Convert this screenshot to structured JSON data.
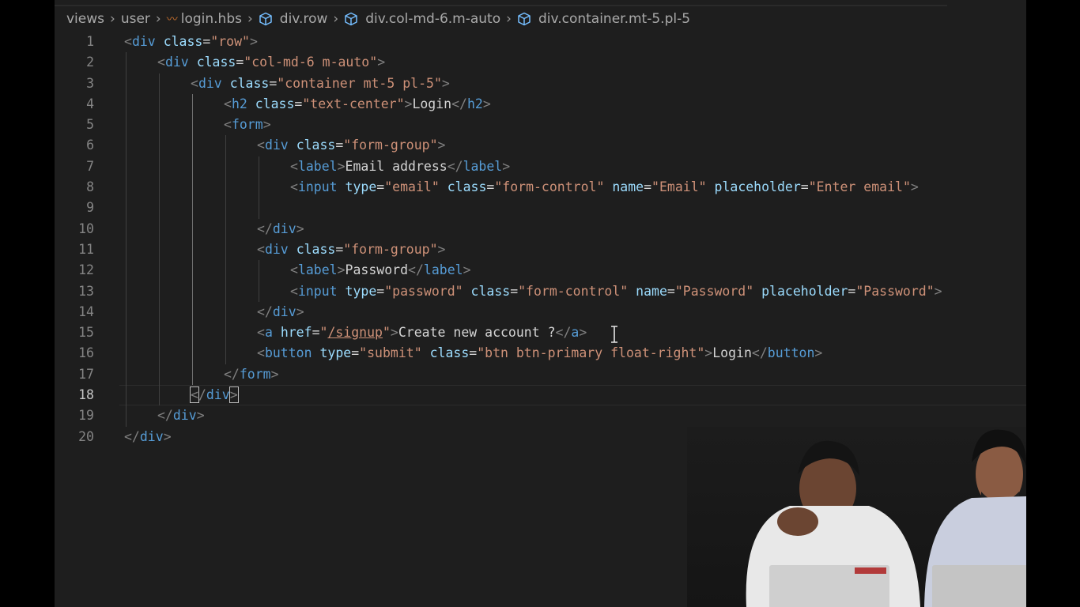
{
  "breadcrumb": [
    {
      "label": "views",
      "icon": null
    },
    {
      "label": "user",
      "icon": null
    },
    {
      "label": "login.hbs",
      "icon": "handlebars-icon"
    },
    {
      "label": "div.row",
      "icon": "cube-icon"
    },
    {
      "label": "div.col-md-6.m-auto",
      "icon": "cube-icon"
    },
    {
      "label": "div.container.mt-5.pl-5",
      "icon": "cube-icon"
    }
  ],
  "editor": {
    "current_line": 18,
    "lines": [
      {
        "n": "1",
        "indent": 0,
        "tokens": [
          [
            "p",
            "<"
          ],
          [
            "t",
            "div"
          ],
          [
            "d",
            " "
          ],
          [
            "a",
            "class"
          ],
          [
            "d",
            "="
          ],
          [
            "s",
            "\"row\""
          ],
          [
            "p",
            ">"
          ]
        ]
      },
      {
        "n": "2",
        "indent": 1,
        "tokens": [
          [
            "p",
            "<"
          ],
          [
            "t",
            "div"
          ],
          [
            "d",
            " "
          ],
          [
            "a",
            "class"
          ],
          [
            "d",
            "="
          ],
          [
            "s",
            "\"col-md-6 m-auto\""
          ],
          [
            "p",
            ">"
          ]
        ]
      },
      {
        "n": "3",
        "indent": 2,
        "tokens": [
          [
            "p",
            "<"
          ],
          [
            "t",
            "div"
          ],
          [
            "d",
            " "
          ],
          [
            "a",
            "class"
          ],
          [
            "d",
            "="
          ],
          [
            "s",
            "\"container mt-5 pl-5\""
          ],
          [
            "p",
            ">"
          ]
        ]
      },
      {
        "n": "4",
        "indent": 3,
        "tokens": [
          [
            "p",
            "<"
          ],
          [
            "t",
            "h2"
          ],
          [
            "d",
            " "
          ],
          [
            "a",
            "class"
          ],
          [
            "d",
            "="
          ],
          [
            "s",
            "\"text-center\""
          ],
          [
            "p",
            ">"
          ],
          [
            "d",
            "Login"
          ],
          [
            "p",
            "</"
          ],
          [
            "t",
            "h2"
          ],
          [
            "p",
            ">"
          ]
        ]
      },
      {
        "n": "5",
        "indent": 3,
        "tokens": [
          [
            "p",
            "<"
          ],
          [
            "t",
            "form"
          ],
          [
            "p",
            ">"
          ]
        ]
      },
      {
        "n": "6",
        "indent": 4,
        "tokens": [
          [
            "p",
            "<"
          ],
          [
            "t",
            "div"
          ],
          [
            "d",
            " "
          ],
          [
            "a",
            "class"
          ],
          [
            "d",
            "="
          ],
          [
            "s",
            "\"form-group\""
          ],
          [
            "p",
            ">"
          ]
        ]
      },
      {
        "n": "7",
        "indent": 5,
        "tokens": [
          [
            "p",
            "<"
          ],
          [
            "t",
            "label"
          ],
          [
            "p",
            ">"
          ],
          [
            "d",
            "Email address"
          ],
          [
            "p",
            "</"
          ],
          [
            "t",
            "label"
          ],
          [
            "p",
            ">"
          ]
        ]
      },
      {
        "n": "8",
        "indent": 5,
        "tokens": [
          [
            "p",
            "<"
          ],
          [
            "t",
            "input"
          ],
          [
            "d",
            " "
          ],
          [
            "a",
            "type"
          ],
          [
            "d",
            "="
          ],
          [
            "s",
            "\"email\""
          ],
          [
            "d",
            " "
          ],
          [
            "a",
            "class"
          ],
          [
            "d",
            "="
          ],
          [
            "s",
            "\"form-control\""
          ],
          [
            "d",
            " "
          ],
          [
            "a",
            "name"
          ],
          [
            "d",
            "="
          ],
          [
            "s",
            "\"Email\""
          ],
          [
            "d",
            " "
          ],
          [
            "a",
            "placeholder"
          ],
          [
            "d",
            "="
          ],
          [
            "s",
            "\"Enter email\""
          ],
          [
            "p",
            ">"
          ]
        ]
      },
      {
        "n": "9",
        "indent": 5,
        "tokens": []
      },
      {
        "n": "10",
        "indent": 4,
        "tokens": [
          [
            "p",
            "</"
          ],
          [
            "t",
            "div"
          ],
          [
            "p",
            ">"
          ]
        ]
      },
      {
        "n": "11",
        "indent": 4,
        "tokens": [
          [
            "p",
            "<"
          ],
          [
            "t",
            "div"
          ],
          [
            "d",
            " "
          ],
          [
            "a",
            "class"
          ],
          [
            "d",
            "="
          ],
          [
            "s",
            "\"form-group\""
          ],
          [
            "p",
            ">"
          ]
        ]
      },
      {
        "n": "12",
        "indent": 5,
        "tokens": [
          [
            "p",
            "<"
          ],
          [
            "t",
            "label"
          ],
          [
            "p",
            ">"
          ],
          [
            "d",
            "Password"
          ],
          [
            "p",
            "</"
          ],
          [
            "t",
            "label"
          ],
          [
            "p",
            ">"
          ]
        ]
      },
      {
        "n": "13",
        "indent": 5,
        "tokens": [
          [
            "p",
            "<"
          ],
          [
            "t",
            "input"
          ],
          [
            "d",
            " "
          ],
          [
            "a",
            "type"
          ],
          [
            "d",
            "="
          ],
          [
            "s",
            "\"password\""
          ],
          [
            "d",
            " "
          ],
          [
            "a",
            "class"
          ],
          [
            "d",
            "="
          ],
          [
            "s",
            "\"form-control\""
          ],
          [
            "d",
            " "
          ],
          [
            "a",
            "name"
          ],
          [
            "d",
            "="
          ],
          [
            "s",
            "\"Password\""
          ],
          [
            "d",
            " "
          ],
          [
            "a",
            "placeholder"
          ],
          [
            "d",
            "="
          ],
          [
            "s",
            "\"Password\""
          ],
          [
            "p",
            ">"
          ]
        ]
      },
      {
        "n": "14",
        "indent": 4,
        "tokens": [
          [
            "p",
            "</"
          ],
          [
            "t",
            "div"
          ],
          [
            "p",
            ">"
          ]
        ]
      },
      {
        "n": "15",
        "indent": 4,
        "tokens": [
          [
            "p",
            "<"
          ],
          [
            "t",
            "a"
          ],
          [
            "d",
            " "
          ],
          [
            "a",
            "href"
          ],
          [
            "d",
            "="
          ],
          [
            "s",
            "\""
          ],
          [
            "su",
            "/signup"
          ],
          [
            "s",
            "\""
          ],
          [
            "p",
            ">"
          ],
          [
            "d",
            "Create new account ?"
          ],
          [
            "p",
            "</"
          ],
          [
            "t",
            "a"
          ],
          [
            "p",
            ">"
          ]
        ]
      },
      {
        "n": "16",
        "indent": 4,
        "tokens": [
          [
            "p",
            "<"
          ],
          [
            "t",
            "button"
          ],
          [
            "d",
            " "
          ],
          [
            "a",
            "type"
          ],
          [
            "d",
            "="
          ],
          [
            "s",
            "\"submit\""
          ],
          [
            "d",
            " "
          ],
          [
            "a",
            "class"
          ],
          [
            "d",
            "="
          ],
          [
            "s",
            "\"btn btn-primary float-right\""
          ],
          [
            "p",
            ">"
          ],
          [
            "d",
            "Login"
          ],
          [
            "p",
            "</"
          ],
          [
            "t",
            "button"
          ],
          [
            "p",
            ">"
          ]
        ]
      },
      {
        "n": "17",
        "indent": 3,
        "tokens": [
          [
            "p",
            "</"
          ],
          [
            "t",
            "form"
          ],
          [
            "p",
            ">"
          ]
        ]
      },
      {
        "n": "18",
        "indent": 2,
        "tokens": [
          [
            "pc",
            "<"
          ],
          [
            "p",
            "/"
          ],
          [
            "t",
            "div"
          ],
          [
            "pc",
            ">"
          ]
        ]
      },
      {
        "n": "19",
        "indent": 1,
        "tokens": [
          [
            "p",
            "</"
          ],
          [
            "t",
            "div"
          ],
          [
            "p",
            ">"
          ]
        ]
      },
      {
        "n": "20",
        "indent": 0,
        "tokens": [
          [
            "p",
            "</"
          ],
          [
            "t",
            "div"
          ],
          [
            "p",
            ">"
          ]
        ]
      }
    ]
  }
}
